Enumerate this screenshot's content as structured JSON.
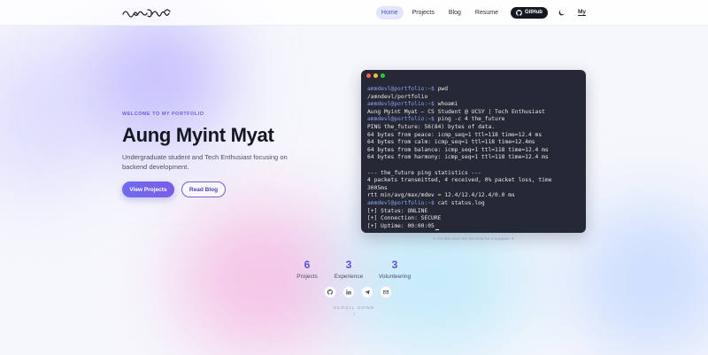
{
  "nav": {
    "items": [
      {
        "label": "Home",
        "active": true
      },
      {
        "label": "Projects",
        "active": false
      },
      {
        "label": "Blog",
        "active": false
      },
      {
        "label": "Resume",
        "active": false
      }
    ],
    "github_label": "GitHub",
    "lang_label": "My"
  },
  "hero": {
    "eyebrow": "WELCOME TO MY PORTFOLIO",
    "name": "Aung Myint Myat",
    "tagline": "Undergraduate student and Tech Enthusiast focusing on backend development.",
    "primary_btn": "View Projects",
    "secondary_btn": "Read Blog"
  },
  "terminal": {
    "prompt": "ammdevl@portfolio:~$",
    "lines": [
      {
        "prompt": true,
        "text": " pwd"
      },
      {
        "prompt": false,
        "text": "/amndevl/portfolio"
      },
      {
        "prompt": true,
        "text": " whoami"
      },
      {
        "prompt": false,
        "text": "Aung Myint Myat — CS Student @ UCSY | Tech Enthusiast"
      },
      {
        "prompt": true,
        "text": " ping -c 4 the_future"
      },
      {
        "prompt": false,
        "text": "PING the_future: 56(84) bytes of data."
      },
      {
        "prompt": false,
        "text": "64 bytes from peace: icmp_seq=1 ttl=118 time=12.4 ms"
      },
      {
        "prompt": false,
        "text": "64 bytes from calm: icmp_seq=1 ttl=118 time=12.4ms"
      },
      {
        "prompt": false,
        "text": "64 bytes from balance: icmp_seq=1 ttl=118 time=12.4 ms"
      },
      {
        "prompt": false,
        "text": "64 bytes from harmony: icmp_seq=1 ttl=118 time=12.4 ms"
      },
      {
        "prompt": false,
        "text": ""
      },
      {
        "prompt": false,
        "text": "--- the_future ping statistics ---"
      },
      {
        "prompt": false,
        "text": "4 packets transmitted, 4 received, 0% packet loss, time"
      },
      {
        "prompt": false,
        "text": "3005ms"
      },
      {
        "prompt": false,
        "text": "rtt min/avg/max/mdev = 12.4/12.4/12.4/0.0 ms"
      },
      {
        "prompt": true,
        "text": " cat status.log"
      },
      {
        "prompt": false,
        "text": "[+] Status: ONLINE"
      },
      {
        "prompt": false,
        "text": "[+] Connection: SECURE"
      },
      {
        "prompt": false,
        "text": "[+] Uptime: 00:00:05",
        "caret": true
      }
    ],
    "hint": "✦ Double-click the terminal for a surprise ✦"
  },
  "stats": [
    {
      "value": "6",
      "label": "Projects"
    },
    {
      "value": "3",
      "label": "Experience"
    },
    {
      "value": "3",
      "label": "Volunteering"
    }
  ],
  "socials": [
    {
      "icon": "github-icon"
    },
    {
      "icon": "linkedin-icon"
    },
    {
      "icon": "telegram-icon"
    },
    {
      "icon": "mail-icon"
    }
  ],
  "scroll_label": "SCROLL DOWN",
  "colors": {
    "accent": "#6d5fe0",
    "terminal_bg": "#252935",
    "prompt": "#8aa1f5"
  }
}
